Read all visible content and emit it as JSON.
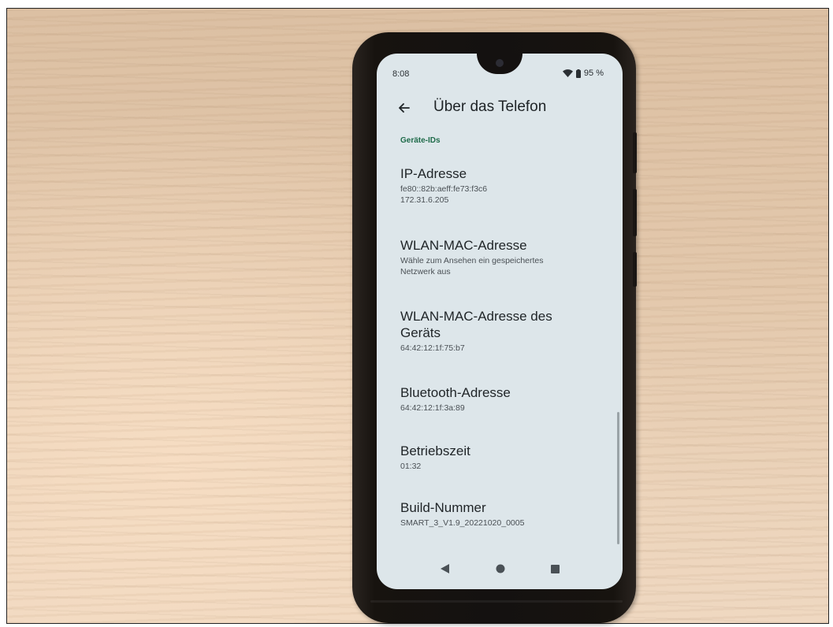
{
  "status_bar": {
    "time": "8:08",
    "battery": "95 %",
    "icons": [
      "wifi-icon",
      "battery-icon"
    ]
  },
  "app_bar": {
    "back_icon": "back-arrow-icon",
    "title": "Über das Telefon"
  },
  "section": {
    "header": "Geräte-IDs"
  },
  "preferences": [
    {
      "title": "IP-Adresse",
      "summary": [
        "fe80::82b:aeff:fe73:f3c6",
        "172.31.6.205"
      ]
    },
    {
      "title": "WLAN-MAC-Adresse",
      "summary": [
        "Wähle zum Ansehen ein gespeichertes",
        "Netzwerk aus"
      ]
    },
    {
      "title": "WLAN-MAC-Adresse des",
      "title2": "Geräts",
      "summary": [
        "64:42:12:1f:75:b7"
      ]
    },
    {
      "title": "Bluetooth-Adresse",
      "summary": [
        "64:42:12:1f:3a:89"
      ]
    },
    {
      "title": "Betriebszeit",
      "summary": [
        "01:32"
      ]
    },
    {
      "title": "Build-Nummer",
      "summary": [
        "SMART_3_V1.9_20221020_0005"
      ]
    }
  ],
  "nav_bar": {
    "icons": [
      "nav-back-icon",
      "nav-home-icon",
      "nav-recents-icon"
    ]
  },
  "colors": {
    "screen_bg": "#dde6ea",
    "section_header": "#1f6b4a",
    "phone_body": "#141110",
    "table_wood": "#e3c8ac"
  }
}
